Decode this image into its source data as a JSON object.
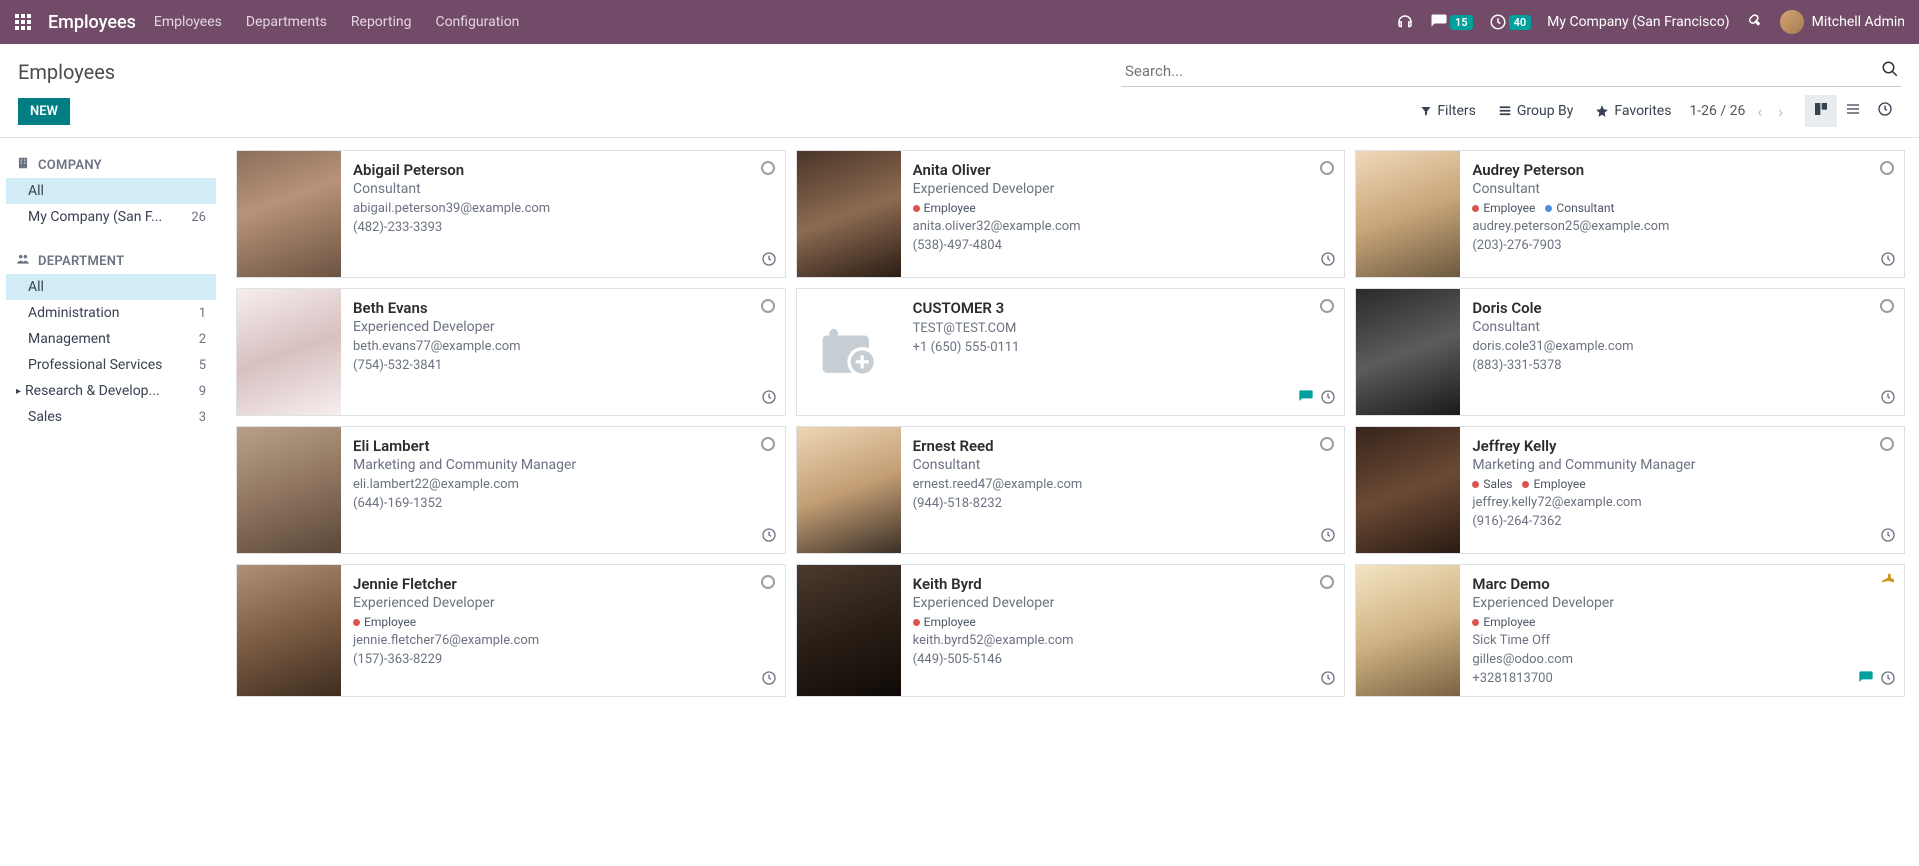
{
  "nav": {
    "brand": "Employees",
    "menu": [
      "Employees",
      "Departments",
      "Reporting",
      "Configuration"
    ],
    "messages_badge": "15",
    "activities_badge": "40",
    "company": "My Company (San Francisco)",
    "user": "Mitchell Admin"
  },
  "control": {
    "title": "Employees",
    "new_label": "NEW",
    "search_placeholder": "Search...",
    "filters_label": "Filters",
    "groupby_label": "Group By",
    "favorites_label": "Favorites",
    "pager": "1-26 / 26"
  },
  "sidebar": {
    "company_header": "COMPANY",
    "company_items": [
      {
        "label": "All",
        "count": "",
        "active": true
      },
      {
        "label": "My Company (San F...",
        "count": "26"
      }
    ],
    "department_header": "DEPARTMENT",
    "department_items": [
      {
        "label": "All",
        "count": "",
        "active": true
      },
      {
        "label": "Administration",
        "count": "1"
      },
      {
        "label": "Management",
        "count": "2"
      },
      {
        "label": "Professional Services",
        "count": "5"
      },
      {
        "label": "Research & Develop...",
        "count": "9",
        "caret": true
      },
      {
        "label": "Sales",
        "count": "3"
      }
    ]
  },
  "cards": [
    {
      "name": "Abigail Peterson",
      "job": "Consultant",
      "tags": [],
      "email": "abigail.peterson39@example.com",
      "phone": "(482)-233-3393",
      "photo": "ph-1",
      "activity": true
    },
    {
      "name": "Anita Oliver",
      "job": "Experienced Developer",
      "tags": [
        {
          "label": "Employee",
          "color": "dot-red"
        }
      ],
      "email": "anita.oliver32@example.com",
      "phone": "(538)-497-4804",
      "photo": "ph-2",
      "activity": true
    },
    {
      "name": "Audrey Peterson",
      "job": "Consultant",
      "tags": [
        {
          "label": "Employee",
          "color": "dot-red"
        },
        {
          "label": "Consultant",
          "color": "dot-blue"
        }
      ],
      "email": "audrey.peterson25@example.com",
      "phone": "(203)-276-7903",
      "photo": "ph-3",
      "activity": true
    },
    {
      "name": "Beth Evans",
      "job": "Experienced Developer",
      "tags": [],
      "email": "beth.evans77@example.com",
      "phone": "(754)-532-3841",
      "photo": "ph-4",
      "activity": true
    },
    {
      "name": "CUSTOMER 3",
      "job": "",
      "tags": [],
      "email": "TEST@TEST.COM",
      "phone": "+1 (650) 555-0111",
      "photo": "ph-none",
      "activity": true,
      "message": true
    },
    {
      "name": "Doris Cole",
      "job": "Consultant",
      "tags": [],
      "email": "doris.cole31@example.com",
      "phone": "(883)-331-5378",
      "photo": "ph-5",
      "activity": true
    },
    {
      "name": "Eli Lambert",
      "job": "Marketing and Community Manager",
      "tags": [],
      "email": "eli.lambert22@example.com",
      "phone": "(644)-169-1352",
      "photo": "ph-6",
      "activity": true
    },
    {
      "name": "Ernest Reed",
      "job": "Consultant",
      "tags": [],
      "email": "ernest.reed47@example.com",
      "phone": "(944)-518-8232",
      "photo": "ph-7",
      "activity": true
    },
    {
      "name": "Jeffrey Kelly",
      "job": "Marketing and Community Manager",
      "tags": [
        {
          "label": "Sales",
          "color": "dot-red"
        },
        {
          "label": "Employee",
          "color": "dot-red"
        }
      ],
      "email": "jeffrey.kelly72@example.com",
      "phone": "(916)-264-7362",
      "photo": "ph-8",
      "activity": true
    },
    {
      "name": "Jennie Fletcher",
      "job": "Experienced Developer",
      "tags": [
        {
          "label": "Employee",
          "color": "dot-red"
        }
      ],
      "email": "jennie.fletcher76@example.com",
      "phone": "(157)-363-8229",
      "photo": "ph-9",
      "activity": true
    },
    {
      "name": "Keith Byrd",
      "job": "Experienced Developer",
      "tags": [
        {
          "label": "Employee",
          "color": "dot-red"
        }
      ],
      "email": "keith.byrd52@example.com",
      "phone": "(449)-505-5146",
      "photo": "ph-10",
      "activity": true
    },
    {
      "name": "Marc Demo",
      "job": "Experienced Developer",
      "tags": [
        {
          "label": "Employee",
          "color": "dot-red"
        }
      ],
      "status": "Sick Time Off",
      "email": "gilles@odoo.com",
      "phone": "+3281813700",
      "photo": "ph-11",
      "activity": true,
      "message": true,
      "away": true
    }
  ]
}
